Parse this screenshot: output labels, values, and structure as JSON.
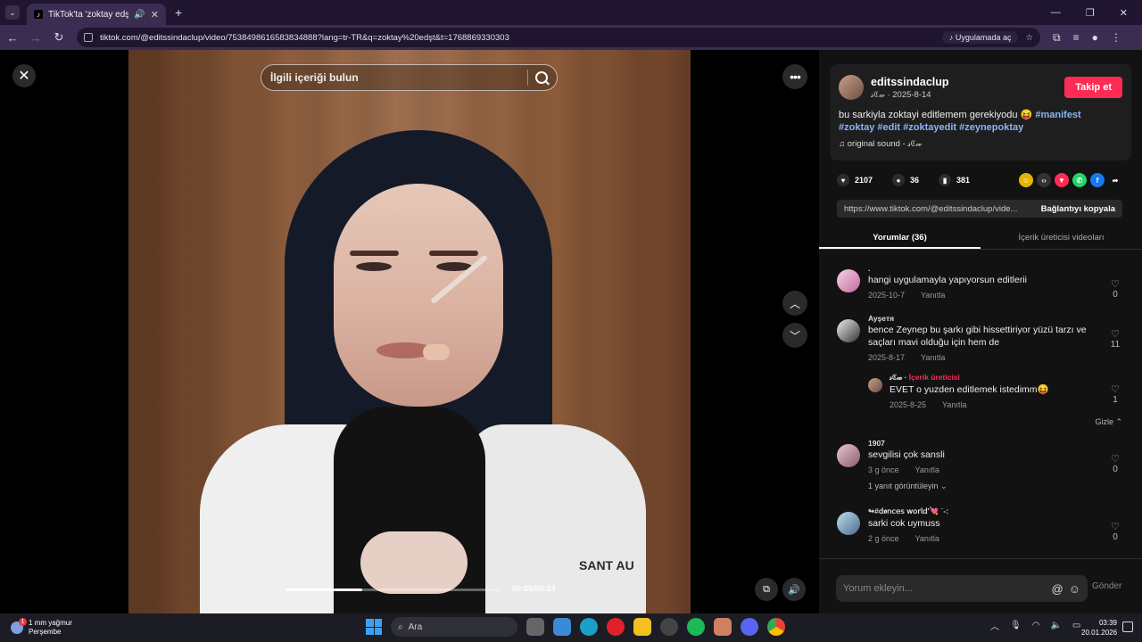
{
  "browser": {
    "tab_title": "TikTok'ta 'zoktay edşt' bulu",
    "url": "tiktok.com/@editssindaclup/video/7538498616583834888?lang=tr-TR&q=zoktay%20edşt&t=1768869330303",
    "open_in_app": "Uygulamada aç"
  },
  "video": {
    "search_placeholder": "İlgili içeriği bulun",
    "timecode": "00:05/00:14",
    "progress_fraction": 0.36,
    "jacket_text": "SANT AU"
  },
  "post": {
    "author": "editssindaclup",
    "author_sub": "𝓈ℭ𝓌 · 2025-8-14",
    "follow_label": "Takip et",
    "description": "bu sarkiyla zoktayi editlemem gerekiyodu 😝",
    "tags_line1": "#manifest",
    "tags_line2": "#zoktay #edit #zoktayedit #zeynepoktay",
    "sound": "♫  original sound - 𝓈ℭ𝓌",
    "likes": "2107",
    "comments": "36",
    "saves": "381",
    "link_url": "https://www.tiktok.com/@editssindaclup/vide...",
    "copy_link_label": "Bağlantıyı kopyala",
    "tab_comments": "Yorumlar (36)",
    "tab_creator_videos": "İçerik üreticisi videoları"
  },
  "comments": [
    {
      "user": ".",
      "text": "hangi uygulamayla yapıyorsun editlerii",
      "date": "2025-10-7",
      "reply": "Yanıtla",
      "likes": "0"
    },
    {
      "user": "Ayşeтя",
      "text": "bence Zeynep bu şarkı gibi hissettiriyor yüzü tarzı ve saçları mavi olduğu için hem de",
      "date": "2025-8-17",
      "reply": "Yanıtla",
      "likes": "11"
    },
    {
      "user": "𝓈ℭ𝓌 ·",
      "creator_label": "İçerik üreticisi",
      "text": "EVET o yuzden editlemek istedimm😝",
      "date": "2025-8-25",
      "reply": "Yanıtla",
      "likes": "1"
    },
    {
      "user": "1907",
      "text": "sevgilisi çok sansli",
      "date": "3 g önce",
      "reply": "Yanıtla",
      "likes": "0",
      "more": "1 yanıt görüntüleyin ⌄"
    },
    {
      "user": "↬#𝖽𝖔𝗇𝖼𝖾𝗌 𝗐𝗈𝗋𝗅𝖽'💘 ˙-:",
      "text": "sarki cok uymuss",
      "date": "2 g önce",
      "reply": "Yanıtla",
      "likes": "0"
    }
  ],
  "hide_label": "Gizle ⌃",
  "comment_box": {
    "placeholder": "Yorum ekleyin...",
    "send_label": "Gönder"
  },
  "taskbar": {
    "weather_line1": "1 mm yağmur",
    "weather_line2": "Perşembe",
    "search_label": "Ara",
    "time": "03:39",
    "date": "20.01.2026"
  },
  "colors": {
    "accent": "#fe2c55",
    "hashtag": "#8ab4f8",
    "chrome": "#3b2d52"
  }
}
